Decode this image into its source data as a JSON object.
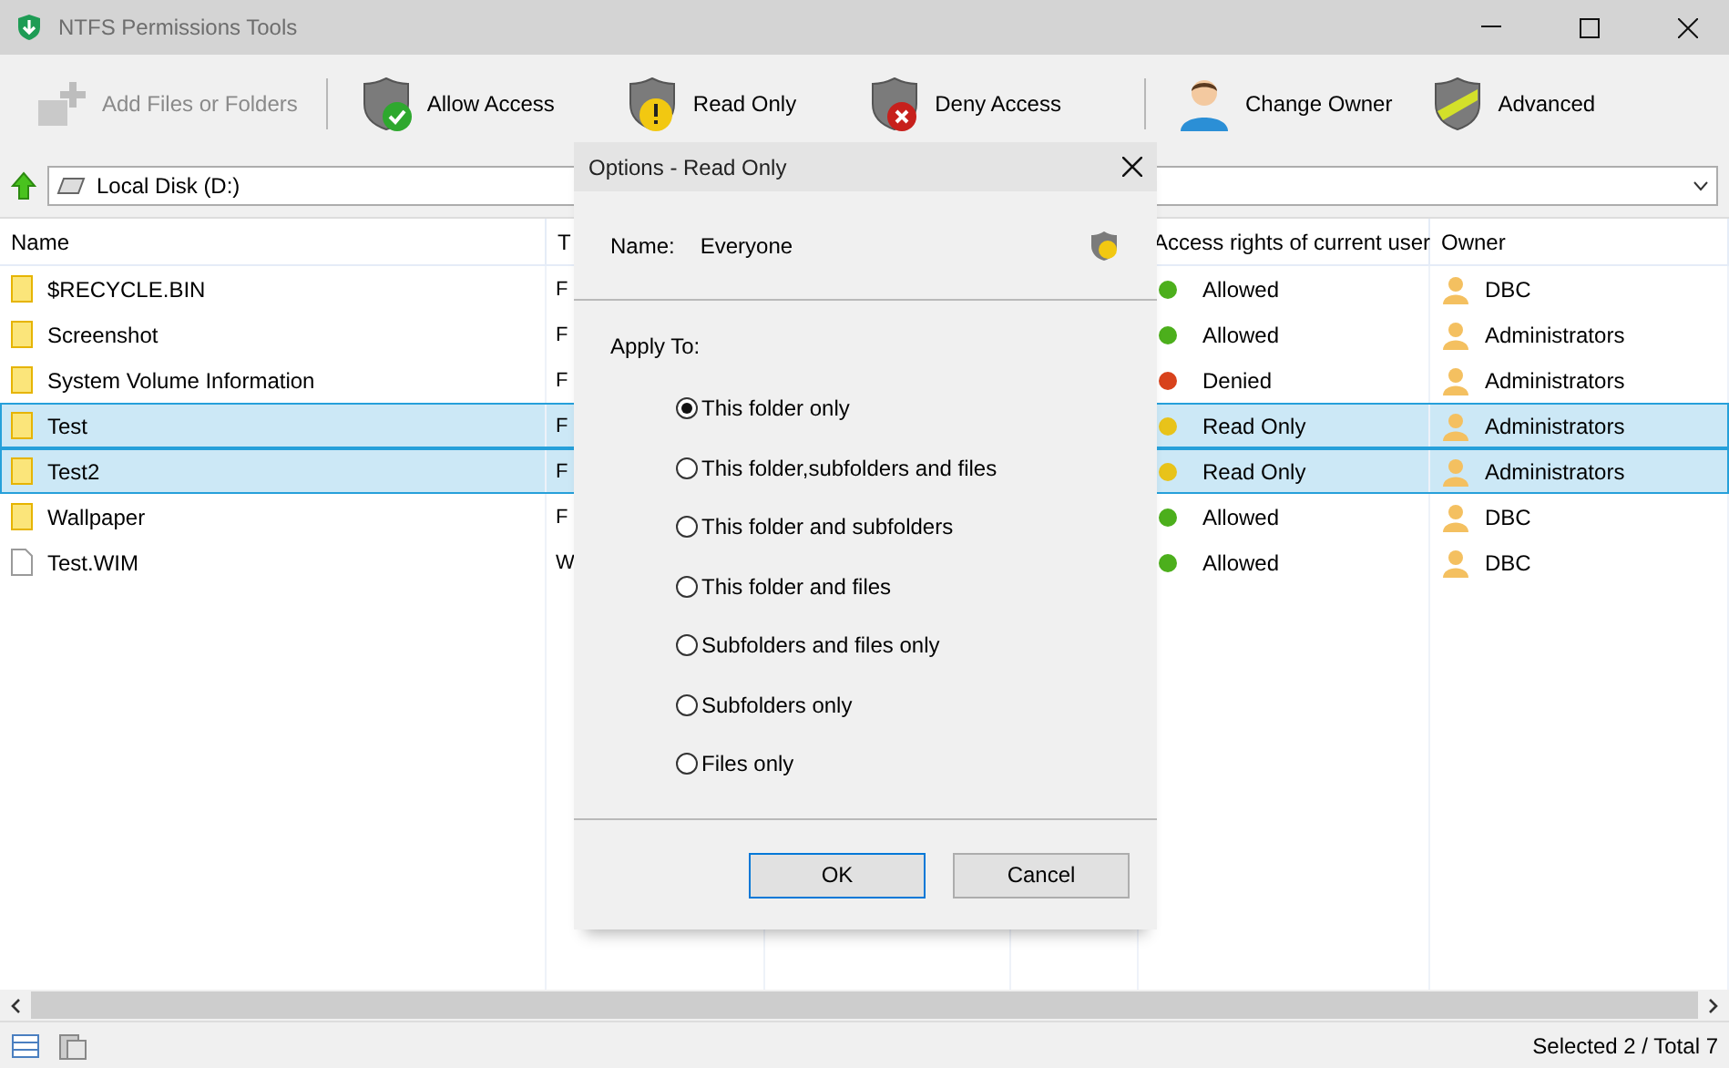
{
  "window": {
    "title": "NTFS Permissions Tools"
  },
  "toolbar": [
    {
      "kind": "add",
      "label": "Add Files or Folders",
      "disabled": true
    },
    {
      "kind": "allow",
      "label": "Allow Access",
      "disabled": false
    },
    {
      "kind": "readonly",
      "label": "Read Only",
      "disabled": false
    },
    {
      "kind": "deny",
      "label": "Deny Access",
      "disabled": false
    },
    {
      "kind": "owner",
      "label": "Change Owner",
      "disabled": false
    },
    {
      "kind": "advanced",
      "label": "Advanced",
      "disabled": false
    }
  ],
  "address": {
    "path": "Local Disk (D:)"
  },
  "table": {
    "columns": {
      "name": "Name",
      "column_2": "T",
      "access": "Access rights of current user",
      "owner": "Owner"
    },
    "rows": [
      {
        "kind": "folder",
        "name": "$RECYCLE.BIN",
        "column_2": "F",
        "access": "Allowed",
        "color": "#4caf1c",
        "owner": "DBC",
        "selected": false
      },
      {
        "kind": "folder",
        "name": "Screenshot",
        "column_2": "F",
        "access": "Allowed",
        "color": "#4caf1c",
        "owner": "Administrators",
        "selected": false
      },
      {
        "kind": "folder",
        "name": "System Volume Information",
        "column_2": "F",
        "access": "Denied",
        "color": "#d8421c",
        "owner": "Administrators",
        "selected": false
      },
      {
        "kind": "folder",
        "name": "Test",
        "column_2": "F",
        "access": "Read Only",
        "color": "#e8c31a",
        "owner": "Administrators",
        "selected": true
      },
      {
        "kind": "folder",
        "name": "Test2",
        "column_2": "F",
        "access": "Read Only",
        "color": "#e8c31a",
        "owner": "Administrators",
        "selected": true
      },
      {
        "kind": "folder",
        "name": "Wallpaper",
        "column_2": "F",
        "access": "Allowed",
        "color": "#4caf1c",
        "owner": "DBC",
        "selected": false
      },
      {
        "kind": "file",
        "name": "Test.WIM",
        "column_2": "W",
        "access": "Allowed",
        "color": "#4caf1c",
        "owner": "DBC",
        "selected": false
      }
    ]
  },
  "dialog": {
    "title": "Options - Read Only",
    "name_label": "Name:",
    "name_value": "Everyone",
    "apply_label": "Apply To:",
    "options": [
      {
        "label": "This folder only",
        "selected": true
      },
      {
        "label": "This folder,subfolders and files",
        "selected": false
      },
      {
        "label": "This folder and subfolders",
        "selected": false
      },
      {
        "label": "This folder and files",
        "selected": false
      },
      {
        "label": "Subfolders and files only",
        "selected": false
      },
      {
        "label": "Subfolders only",
        "selected": false
      },
      {
        "label": "Files only",
        "selected": false
      }
    ],
    "buttons": [
      {
        "label": "OK",
        "default": true
      },
      {
        "label": "Cancel",
        "default": false
      }
    ]
  },
  "status_bar": {
    "text": "Selected 2 / Total 7"
  }
}
